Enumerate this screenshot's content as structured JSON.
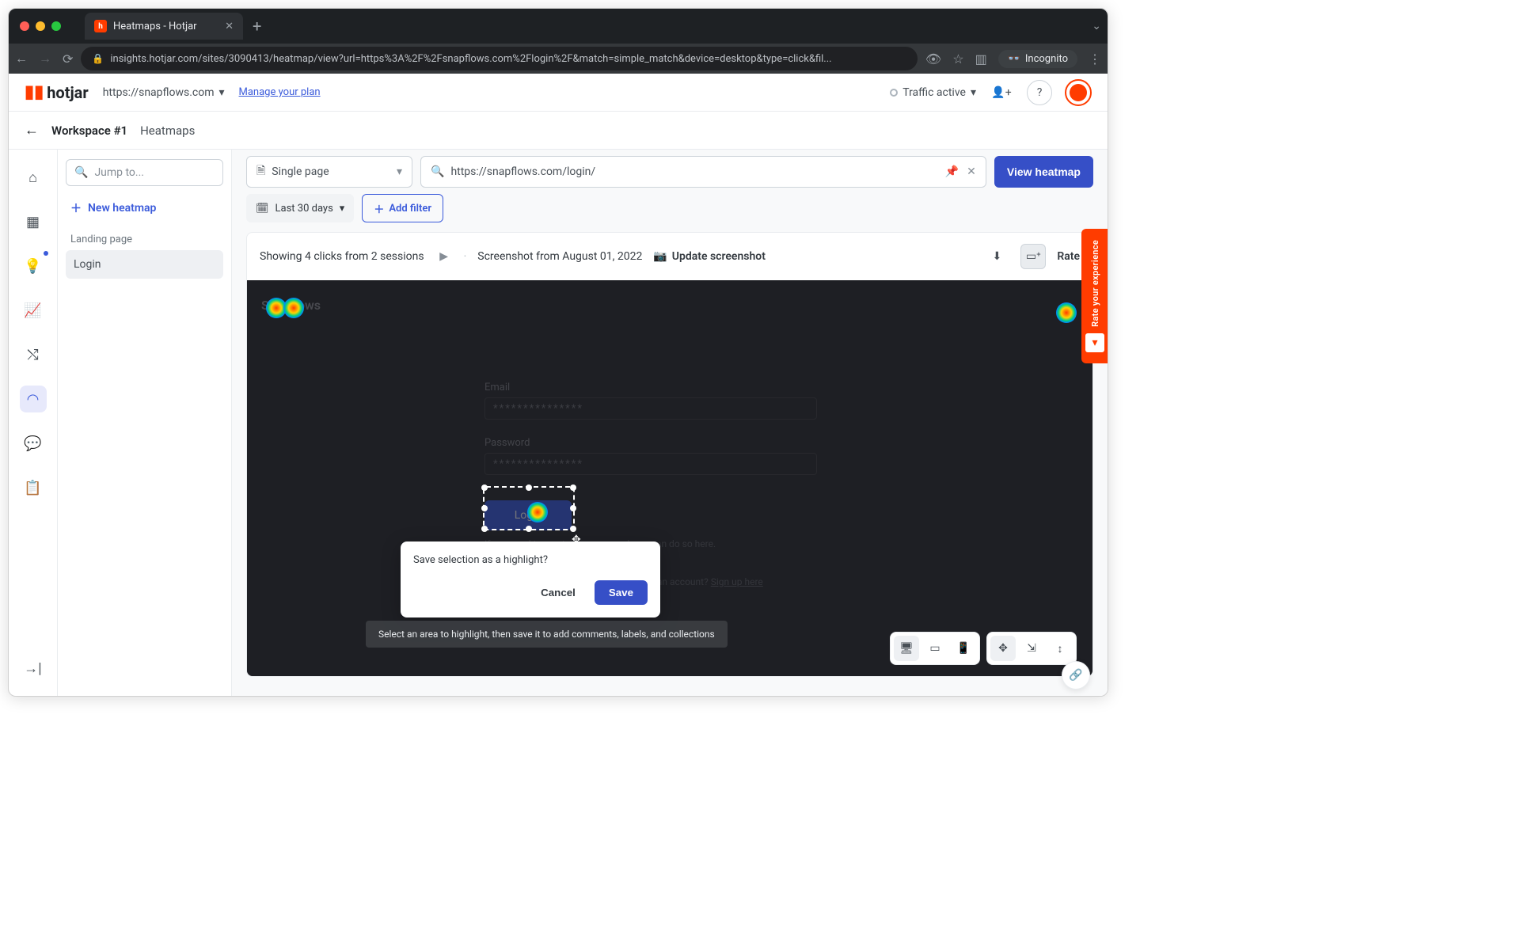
{
  "browser": {
    "tab_title": "Heatmaps - Hotjar",
    "url": "insights.hotjar.com/sites/3090413/heatmap/view?url=https%3A%2F%2Fsnapflows.com%2Flogin%2F&match=simple_match&device=desktop&type=click&fil...",
    "incognito_label": "Incognito"
  },
  "header": {
    "logo": "hotjar",
    "site": "https://snapflows.com",
    "manage_plan": "Manage your plan",
    "traffic": "Traffic active"
  },
  "breadcrumb": {
    "workspace": "Workspace #1",
    "page": "Heatmaps"
  },
  "sidebar": {
    "jump_placeholder": "Jump to...",
    "new_heatmap": "New heatmap",
    "group_label": "Landing page",
    "items": [
      {
        "label": "Login",
        "selected": true
      }
    ]
  },
  "toolbar": {
    "page_mode": "Single page",
    "url": "https://snapflows.com/login/",
    "view_btn": "View heatmap",
    "date": "Last 30 days",
    "add_filter": "Add filter"
  },
  "card": {
    "summary": "Showing 4 clicks from 2 sessions",
    "screenshot_date": "Screenshot from August 01, 2022",
    "update": "Update screenshot",
    "rate": "Rate"
  },
  "ghost": {
    "brand": "Snapflows",
    "email_label": "Email",
    "password_label": "Password",
    "masked": "***************",
    "login_btn": "Login",
    "reset": "If you need to reset your password, you can do so here.",
    "signup_prompt": "Don't have an account? ",
    "signup_link": "Sign up here"
  },
  "popover": {
    "question": "Save selection as a highlight?",
    "cancel": "Cancel",
    "save": "Save"
  },
  "hint": "Select an area to highlight, then save it to add comments, labels, and collections",
  "rate_widget": "Rate your experience"
}
